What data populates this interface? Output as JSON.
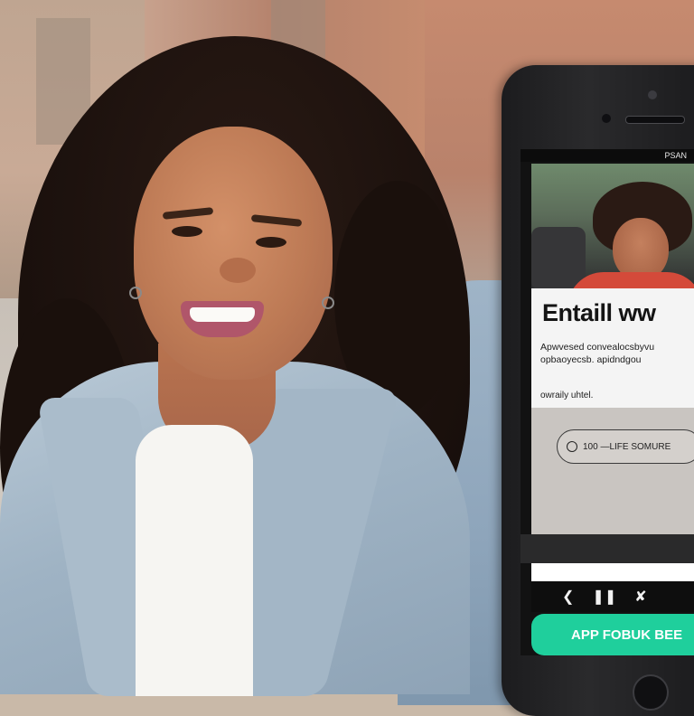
{
  "screen": {
    "status": {
      "left": "",
      "right": "PSAN"
    },
    "headline": "Entaill ww",
    "body_lines": [
      "Apwvesed convealocsbyvu",
      "opbaoyecsb. apidndgou"
    ],
    "small_text": "owraily uhtel.",
    "pill_input": "100 —LIFE SOMURE",
    "nav_icons": [
      "back-icon",
      "pause-icon",
      "share-icon"
    ],
    "nav_glyphs": [
      "❮",
      "❚❚",
      "✘"
    ],
    "cta_label": "APP FOBUK BEE"
  },
  "colors": {
    "cta": "#1fcf9c",
    "phone_body": "#1c1c1e",
    "jacket": "#9fb3c4",
    "hero_shirt": "#d44a3a"
  }
}
